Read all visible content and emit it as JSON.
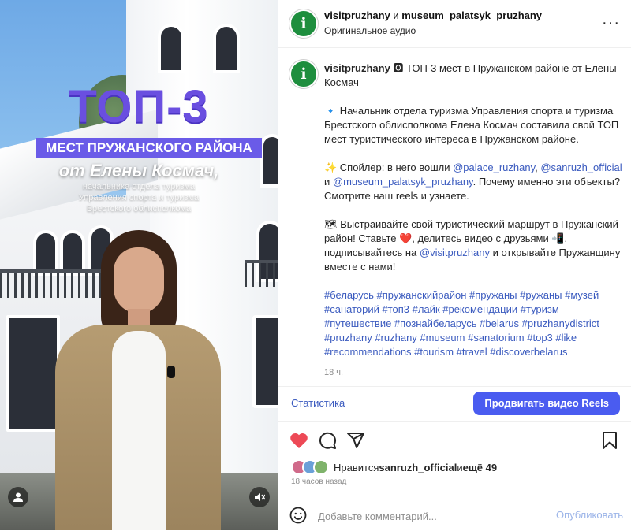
{
  "video": {
    "title_big": "ТОП-3",
    "title_bar": "МЕСТ ПРУЖАНСКОГО РАЙОНА",
    "title_author": "от Елены Космач,",
    "sub_line1": "начальника отдела туризма",
    "sub_line2": "Управления спорта и туризма",
    "sub_line3": "Брестского облисполкома"
  },
  "header": {
    "user1": "visitpruzhany",
    "and": " и ",
    "user2": "museum_palatsyk_pruzhany",
    "audio": "Оригинальное аудио",
    "more": "···"
  },
  "caption": {
    "user": "visitpruzhany",
    "title": " 🅾 ТОП-3 мест в Пружанском районе от Елены Космач",
    "p1": "🔹 Начальник отдела туризма Управления спорта и туризма Брестского облисполкома Елена Космач составила свой ТОП мест туристического интереса в Пружанском районе.",
    "p2_a": "✨ Спойлер: в него вошли ",
    "m1": "@palace_ruzhany",
    "p2_b": ", ",
    "m2": "@sanruzh_official",
    "p2_c": " и ",
    "m3": "@museum_palatsyk_pruzhany",
    "p2_d": ". Почему именно эти объекты? Смотрите наш reels и узнаете.",
    "p3_a": "🗺 Выстраивайте свой туристический маршрут в Пружанский район! Ставьте ❤️, делитесь видео с друзьями 📲, подписывайтесь на ",
    "m4": "@visitpruzhany",
    "p3_b": " и открывайте Пружанщину вместе с нами!",
    "hashtags": "#беларусь #пружанскийрайон #пружаны #ружаны #музей #санаторий #топ3 #лайк #рекомендации #туризм #путешествие #познайбеларусь #belarus #pruzhanydistrict #pruzhany #ruzhany #museum #sanatorium #top3 #like #recommendations #tourism #travel #discoverbelarus",
    "time": "18 ч."
  },
  "insights": {
    "stats": "Статистика",
    "promote": "Продвигать видео Reels"
  },
  "likes": {
    "prefix": "Нравится ",
    "user": "sanruzh_official",
    "mid": " и ",
    "count": "ещё 49"
  },
  "ago": "18 часов назад",
  "comment": {
    "placeholder": "Добавьте комментарий...",
    "publish": "Опубликовать"
  },
  "colors": {
    "accent": "#4a5cf0",
    "link": "#3b5bbf",
    "like": "#ed4956",
    "avatar": "#1e8e3e"
  },
  "icons": [
    "info-logo-icon",
    "more-icon",
    "heart-icon",
    "comment-icon",
    "share-icon",
    "bookmark-icon",
    "emoji-icon",
    "profile-icon",
    "mute-icon"
  ]
}
